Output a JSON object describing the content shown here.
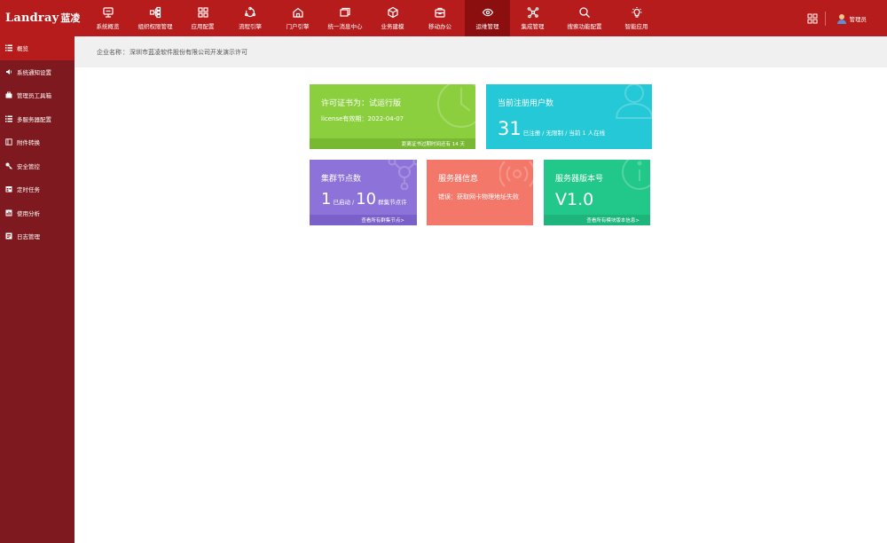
{
  "brand": {
    "name_en": "Landray",
    "name_cn": "蓝凌"
  },
  "nav": {
    "items": [
      {
        "label": "系统概览",
        "icon": "monitor-icon"
      },
      {
        "label": "组织权限管理",
        "icon": "org-tree-icon"
      },
      {
        "label": "应用配置",
        "icon": "grid-icon"
      },
      {
        "label": "流程引擎",
        "icon": "flow-cycle-icon"
      },
      {
        "label": "门户引擎",
        "icon": "home-icon"
      },
      {
        "label": "统一消息中心",
        "icon": "message-icon"
      },
      {
        "label": "业务建模",
        "icon": "cube-icon"
      },
      {
        "label": "移动办公",
        "icon": "briefcase-icon"
      },
      {
        "label": "运维管理",
        "icon": "eye-icon",
        "active": true
      },
      {
        "label": "集成管理",
        "icon": "network-icon"
      },
      {
        "label": "搜索功能配置",
        "icon": "search-icon"
      },
      {
        "label": "智能应用",
        "icon": "bulb-icon"
      }
    ],
    "user_name": "管理员"
  },
  "sidebar": {
    "items": [
      {
        "label": "概览",
        "icon": "list-icon",
        "active": true
      },
      {
        "label": "系统通知设置",
        "icon": "speaker-icon"
      },
      {
        "label": "管理员工具箱",
        "icon": "toolbox-icon"
      },
      {
        "label": "多服务器配置",
        "icon": "server-list-icon"
      },
      {
        "label": "附件转换",
        "icon": "attachment-convert-icon"
      },
      {
        "label": "安全管控",
        "icon": "key-icon"
      },
      {
        "label": "定时任务",
        "icon": "calendar-icon"
      },
      {
        "label": "使用分析",
        "icon": "chart-icon"
      },
      {
        "label": "日志管理",
        "icon": "log-icon"
      }
    ]
  },
  "breadcrumb": {
    "label": "企业名称",
    "separator": "：",
    "value": "深圳市蓝凌软件股份有限公司开发演示许可"
  },
  "cards": {
    "license": {
      "title_prefix": "许可证书为：",
      "title_value": "试运行版",
      "expiry": "license有效期：2022-04-07",
      "footer": "距离证书过期时间还有 14 天"
    },
    "users": {
      "title": "当前注册用户数",
      "count": "31",
      "detail": "已注册 / 无限制 / 当前 1 人在线"
    },
    "cluster": {
      "title": "集群节点数",
      "started": "1",
      "started_label": "已启动 /",
      "total": "10",
      "total_label": "群集节点许",
      "footer": "查看所有群集节点>"
    },
    "server": {
      "title": "服务器信息",
      "error": "错误：获取网卡物理地址失败"
    },
    "version": {
      "title": "服务器版本号",
      "value": "V1.0",
      "footer": "查看所有模块版本信息>"
    }
  },
  "colors": {
    "topbar": "#b71c1c",
    "sidebar": "#7e1a1f",
    "license": "#8bcf3e",
    "users": "#24c8d6",
    "cluster": "#8d72d9",
    "server": "#f4786a",
    "version": "#22c88a"
  }
}
